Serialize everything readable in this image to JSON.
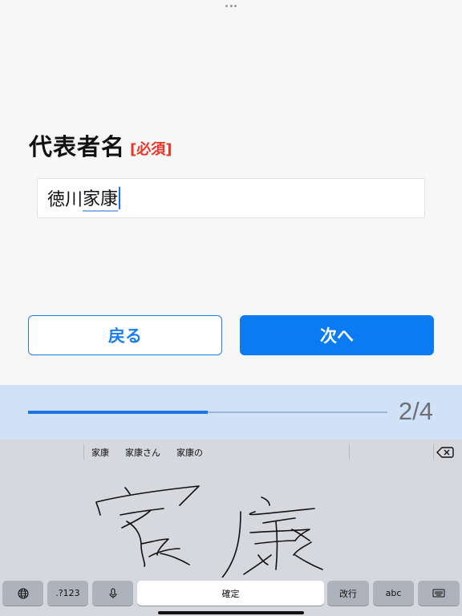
{
  "form": {
    "field_label": "代表者名",
    "required_tag": "[必須]",
    "name_prefix": "徳川",
    "name_composing": "家康"
  },
  "buttons": {
    "back_label": "戻る",
    "next_label": "次へ"
  },
  "progress": {
    "current_label": "2/4",
    "fraction": 0.5
  },
  "keyboard": {
    "candidates": [
      "家康",
      "家康さん",
      "家康の"
    ],
    "keys": {
      "globe_icon": "globe-icon",
      "numbers_label": ".?123",
      "mic_icon": "microphone-icon",
      "confirm_label": "確定",
      "return_label": "改行",
      "abc_label": "abc",
      "dismiss_icon": "keyboard-dismiss-icon"
    }
  },
  "colors": {
    "accent": "#0a7bf2",
    "required": "#e5372a",
    "progress_bg": "#cfe2f7"
  }
}
